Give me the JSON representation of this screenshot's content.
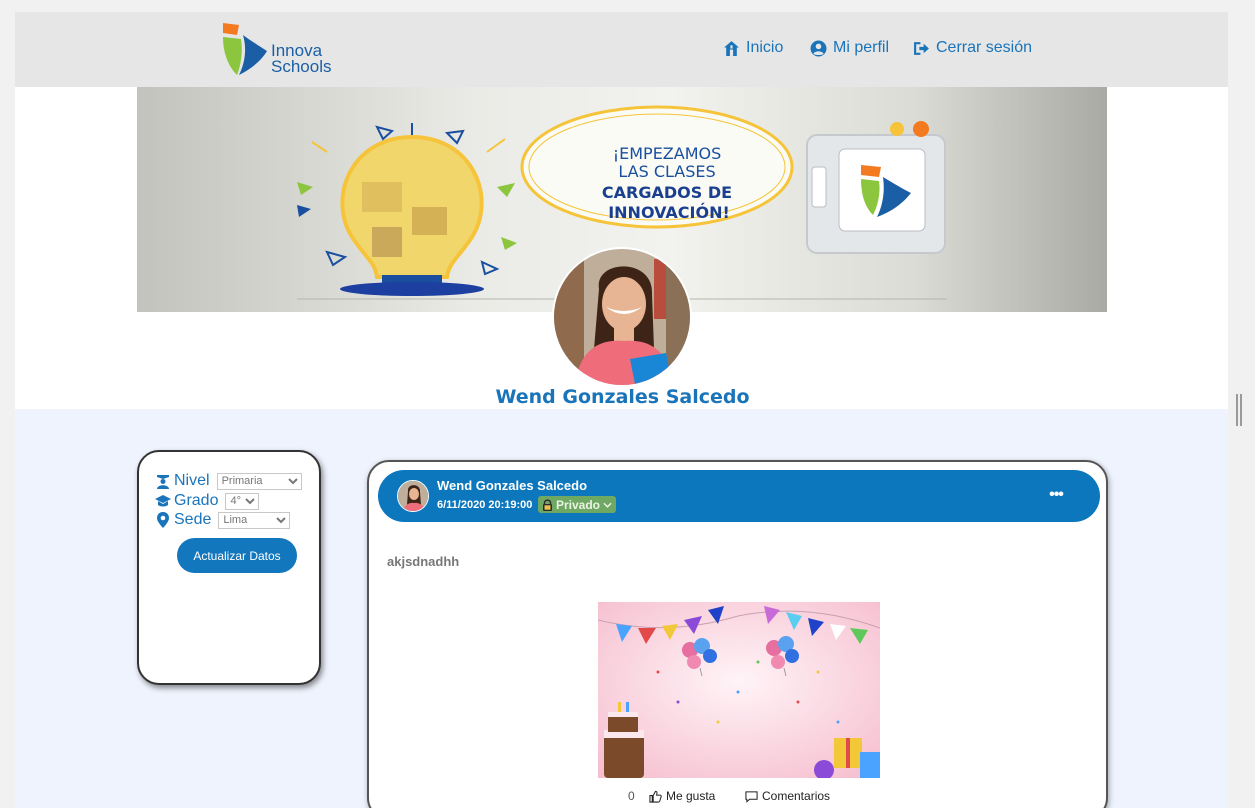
{
  "header": {
    "logo_text_line1": "Innova",
    "logo_text_line2": "Schools",
    "nav": [
      {
        "label": "Inicio",
        "icon": "home-icon"
      },
      {
        "label": "Mi perfil",
        "icon": "user-circle-icon"
      },
      {
        "label": "Cerrar sesión",
        "icon": "sign-out-icon"
      }
    ]
  },
  "banner": {
    "line1": "¡EMPEZAMOS",
    "line2": "LAS CLASES",
    "line3": "CARGADOS DE",
    "line4": "INNOVACIÓN!"
  },
  "profile": {
    "name": "Wend Gonzales Salcedo"
  },
  "filters": {
    "nivel": {
      "label": "Nivel",
      "value": "Primaria"
    },
    "grado": {
      "label": "Grado",
      "value": "4°"
    },
    "sede": {
      "label": "Sede",
      "value": "Lima"
    },
    "button": "Actualizar Datos"
  },
  "post": {
    "author": "Wend Gonzales Salcedo",
    "datetime": "6/11/2020 20:19:00",
    "privacy": "Privado",
    "more": "•••",
    "text": "akjsdnadhh",
    "likes_count": "0",
    "like_label": "Me gusta",
    "comments_label": "Comentarios"
  },
  "colors": {
    "accent": "#1a74ba",
    "header_bg": "#e6e6e6",
    "post_header": "#0d77bd",
    "privacy_badge": "#6fa862",
    "lower_bg": "#eff3fd"
  }
}
